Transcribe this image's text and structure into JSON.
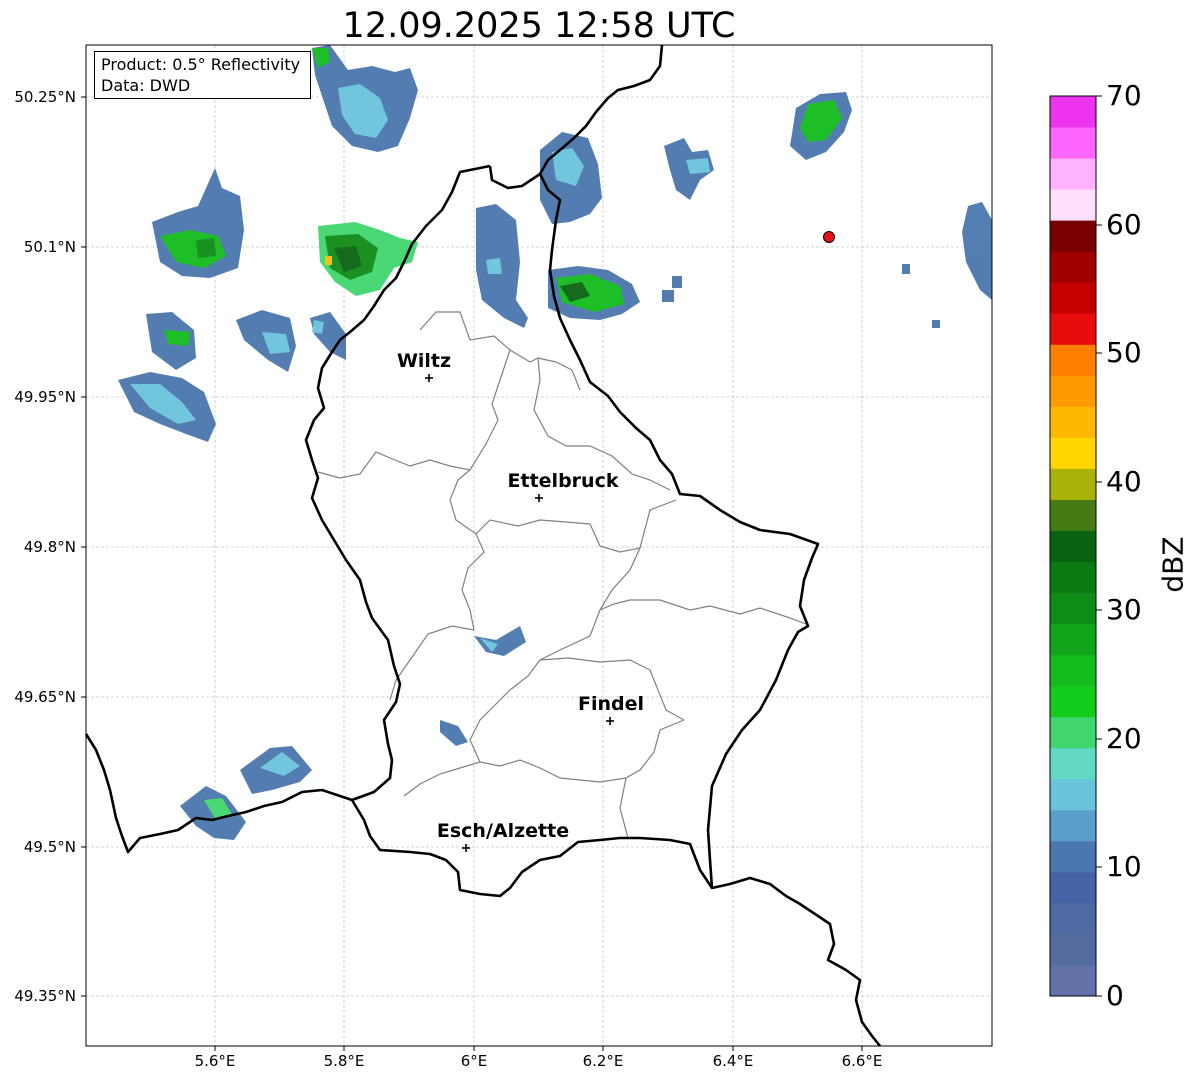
{
  "title": "12.09.2025 12:58 UTC",
  "info_box": {
    "product": "Product: 0.5° Reflectivity",
    "data": "Data: DWD"
  },
  "latitude_ticks": [
    "50.25°N",
    "50.1°N",
    "49.95°N",
    "49.8°N",
    "49.65°N",
    "49.5°N",
    "49.35°N"
  ],
  "longitude_ticks": [
    "5.6°E",
    "5.8°E",
    "6°E",
    "6.2°E",
    "6.4°E",
    "6.6°E"
  ],
  "cities": [
    {
      "name": "Wiltz",
      "lon": 5.93,
      "lat": 49.97
    },
    {
      "name": "Ettelbruck",
      "lon": 6.1,
      "lat": 49.85
    },
    {
      "name": "Findel",
      "lon": 6.21,
      "lat": 49.63
    },
    {
      "name": "Esch/Alzette",
      "lon": 5.99,
      "lat": 49.5
    }
  ],
  "radar_site_marker": {
    "lon": 6.55,
    "lat": 50.11,
    "color": "#e8101a"
  },
  "colorbar": {
    "label": "dBZ",
    "range": [
      0,
      70
    ],
    "tick_labels": [
      "70",
      "60",
      "50",
      "40",
      "30",
      "20",
      "10",
      "0"
    ],
    "step": 2.5,
    "colors": [
      "#6272a8",
      "#536b9e",
      "#4e6aa2",
      "#4563a6",
      "#4a77ad",
      "#5a9fc9",
      "#6ac3dc",
      "#63d9c4",
      "#41d56e",
      "#13cc1c",
      "#13bb1c",
      "#11a51a",
      "#0f8c16",
      "#0c7a12",
      "#0a6313",
      "#467a12",
      "#aab20a",
      "#ffd600",
      "#ffb800",
      "#ff9b00",
      "#ff7f00",
      "#e80c0c",
      "#c40000",
      "#a00000",
      "#780000",
      "#ffe0ff",
      "#ffb3ff",
      "#ff66ff",
      "#ee33ee"
    ]
  },
  "map_extent": {
    "lon": [
      5.4,
      6.8
    ],
    "lat": [
      49.3,
      50.3
    ]
  },
  "gridlines": true,
  "colors": {
    "border": "#000000",
    "cantons": "#808080",
    "grid": "#c8c8c8"
  }
}
